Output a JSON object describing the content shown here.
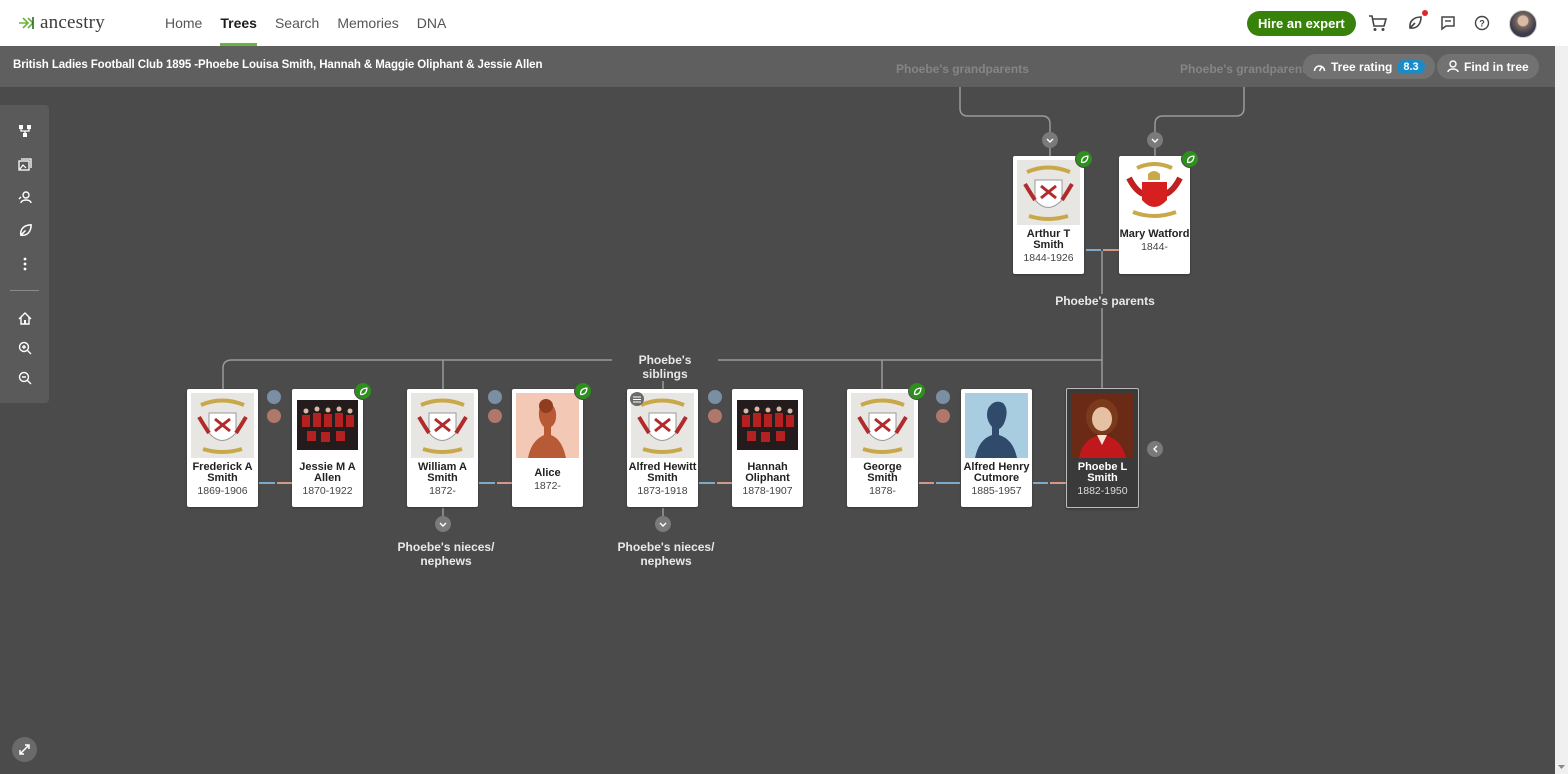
{
  "brand": {
    "name": "ancestry"
  },
  "nav": {
    "items": [
      {
        "label": "Home"
      },
      {
        "label": "Trees",
        "active": true
      },
      {
        "label": "Search"
      },
      {
        "label": "Memories"
      },
      {
        "label": "DNA"
      }
    ]
  },
  "header": {
    "hire_label": "Hire an expert"
  },
  "tree": {
    "title": "British Ladies Football Club 1895 -Phoebe Louisa Smith, Hannah & Maggie Oliphant & Jessie Allen",
    "rating_label": "Tree rating",
    "rating_value": "8.3",
    "find_label": "Find in tree"
  },
  "labels": {
    "grandparents_left": "Phoebe's grandparents",
    "grandparents_right": "Phoebe's grandparent",
    "parents": "Phoebe's parents",
    "siblings": "Phoebe's siblings",
    "nieces_1": "Phoebe's nieces/ nephews",
    "nieces_2": "Phoebe's nieces/ nephews"
  },
  "people": {
    "arthur": {
      "name": "Arthur T Smith",
      "dates": "1844-1926"
    },
    "mary": {
      "name": "Mary Watford",
      "dates": "1844-"
    },
    "frederick": {
      "name": "Frederick A Smith",
      "dates": "1869-1906"
    },
    "jessie": {
      "name": "Jessie M A Allen",
      "dates": "1870-1922"
    },
    "william": {
      "name": "William A Smith",
      "dates": "1872-"
    },
    "alice": {
      "name": "Alice",
      "dates": "1872-"
    },
    "alfredh": {
      "name": "Alfred Hewitt Smith",
      "dates": "1873-1918"
    },
    "hannah": {
      "name": "Hannah Oliphant",
      "dates": "1878-1907"
    },
    "george": {
      "name": "George Smith",
      "dates": "1878-"
    },
    "alfredc": {
      "name": "Alfred Henry Cutmore",
      "dates": "1885-1957"
    },
    "phoebe": {
      "name": "Phoebe L Smith",
      "dates": "1882-1950"
    }
  },
  "colors": {
    "accent_green": "#38810a",
    "nav_underline": "#6cb33f",
    "rating_blue": "#1a8bc9",
    "canvas": "#4b4b4b"
  }
}
